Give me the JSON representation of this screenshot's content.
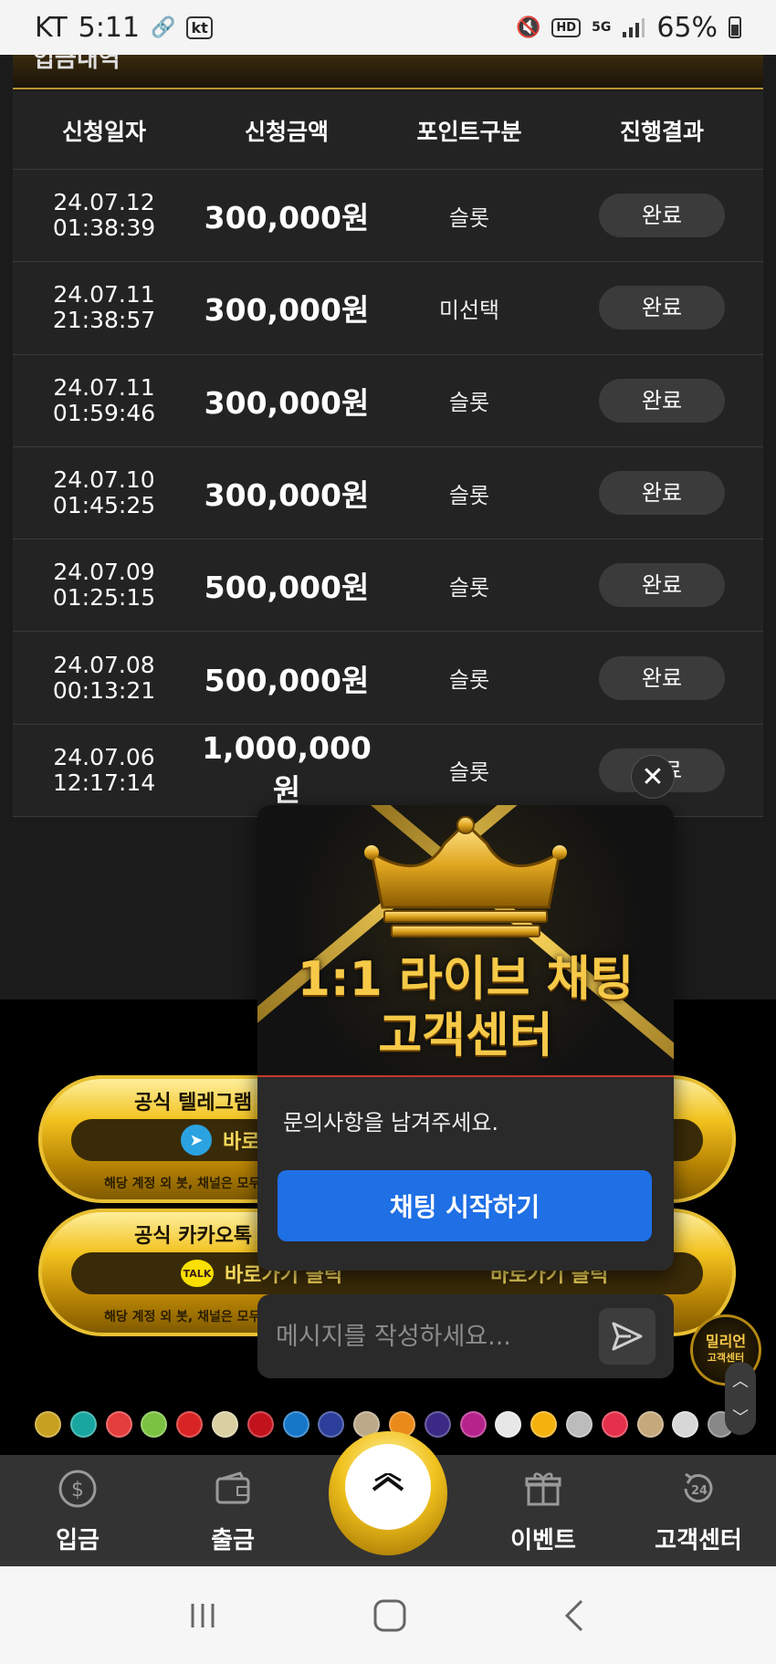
{
  "status_bar": {
    "carrier": "KT",
    "time": "5:11",
    "battery": "65%"
  },
  "section": {
    "title": "입금내역"
  },
  "table": {
    "headers": [
      "신청일자",
      "신청금액",
      "포인트구분",
      "진행결과"
    ],
    "currency_unit": "원",
    "rows": [
      {
        "date": "24.07.12",
        "time": "01:38:39",
        "amount": "300,000",
        "type": "슬롯",
        "status": "완료"
      },
      {
        "date": "24.07.11",
        "time": "21:38:57",
        "amount": "300,000",
        "type": "미선택",
        "status": "완료"
      },
      {
        "date": "24.07.11",
        "time": "01:59:46",
        "amount": "300,000",
        "type": "슬롯",
        "status": "완료"
      },
      {
        "date": "24.07.10",
        "time": "01:45:25",
        "amount": "300,000",
        "type": "슬롯",
        "status": "완료"
      },
      {
        "date": "24.07.09",
        "time": "01:25:15",
        "amount": "500,000",
        "type": "슬롯",
        "status": "완료"
      },
      {
        "date": "24.07.08",
        "time": "00:13:21",
        "amount": "500,000",
        "type": "슬롯",
        "status": "완료"
      },
      {
        "date": "24.07.06",
        "time": "12:17:14",
        "amount": "1,000,000",
        "type": "슬롯",
        "status": "완료"
      }
    ]
  },
  "banners": {
    "telegram": {
      "title": "공식 텔레그램 바",
      "cta": "바로가기 클릭",
      "note": "해당 계정 외 봇, 채널은 모두 사칭"
    },
    "kakao": {
      "title": "공식 카카오톡 바",
      "cta": "바로가기 클릭",
      "note": "해당 계정 외 봇, 채널은 모두 사칭",
      "icon_text": "TALK"
    },
    "right_cta": "바로가기 클릭"
  },
  "chat": {
    "hero_line1": "1:1 라이브 채팅",
    "hero_line2": "고객센터",
    "message": "문의사항을 남겨주세요.",
    "start_button": "채팅 시작하기",
    "input_placeholder": "메시지를 작성하세요...",
    "close_symbol": "✕"
  },
  "cs_badge": {
    "line1": "밀리언",
    "line2": "고객센터"
  },
  "bottom_nav": {
    "items": [
      {
        "label": "입금",
        "icon": "dollar-coin-icon"
      },
      {
        "label": "출금",
        "icon": "wallet-icon"
      },
      {
        "label": "",
        "icon": "scroll-top-icon"
      },
      {
        "label": "이벤트",
        "icon": "gift-icon"
      },
      {
        "label": "고객센터",
        "icon": "24h-support-icon"
      }
    ]
  },
  "colors": {
    "gold": "#f1c21d",
    "accent_blue": "#1f6fe5",
    "background": "#1b1b1b"
  }
}
